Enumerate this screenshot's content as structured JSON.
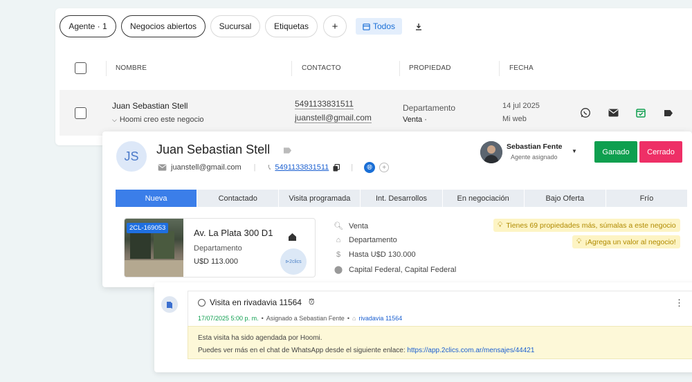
{
  "filters": {
    "agent": "Agente · 1",
    "open_deals": "Negocios abiertos",
    "branch": "Sucursal",
    "tags": "Etiquetas",
    "add": "+",
    "todos": "Todos"
  },
  "table": {
    "headers": [
      "NOMBRE",
      "CONTACTO",
      "PROPIEDAD",
      "FECHA"
    ],
    "row": {
      "name": "Juan Sebastian Stell",
      "subtitle": "Hoomi creo este negocio",
      "phone": "5491133831511",
      "email": "juanstell@gmail.com",
      "property_type": "Departamento",
      "operation": "Venta ·",
      "date": "14 jul 2025",
      "source": "Mi web"
    }
  },
  "detail": {
    "initials": "JS",
    "name": "Juan Sebastian Stell",
    "email": "juanstell@gmail.com",
    "phone": "5491133831511",
    "agent_name": "Sebastian Fente",
    "agent_role": "Agente asignado",
    "won_label": "Ganado",
    "closed_label": "Cerrado",
    "colors": {
      "won": "#0e9f4f",
      "closed": "#ee2f66",
      "active_step": "#3b7ee9"
    },
    "stages": [
      "Nueva",
      "Contactado",
      "Visita programada",
      "Int. Desarrollos",
      "En negociación",
      "Bajo Oferta",
      "Frío"
    ],
    "active_stage": "Nueva",
    "property": {
      "code": "2CL-169053",
      "title": "Av. La Plata 300 D1",
      "type": "Departamento",
      "price": "U$D 113.000",
      "logo": "2clics"
    },
    "search": {
      "operation": "Venta",
      "type": "Departamento",
      "budget": "Hasta U$D 130.000",
      "location": "Capital Federal, Capital Federal"
    },
    "hints": {
      "more_props": "Tienes 69 propiedades más, súmalas a este negocio",
      "add_value": "¡Agrega un valor al negocio!"
    }
  },
  "activity": {
    "title": "Visita en rivadavia 11564",
    "datetime": "17/07/2025 5:00 p. m.",
    "assigned": "Asignado a Sebastian Fente",
    "place": "rivadavia 11564",
    "line1": "Esta visita ha sido agendada por Hoomi.",
    "line2_prefix": "Puedes ver más en el chat de WhatsApp desde el siguiente enlace: ",
    "link": "https://app.2clics.com.ar/mensajes/44421"
  }
}
